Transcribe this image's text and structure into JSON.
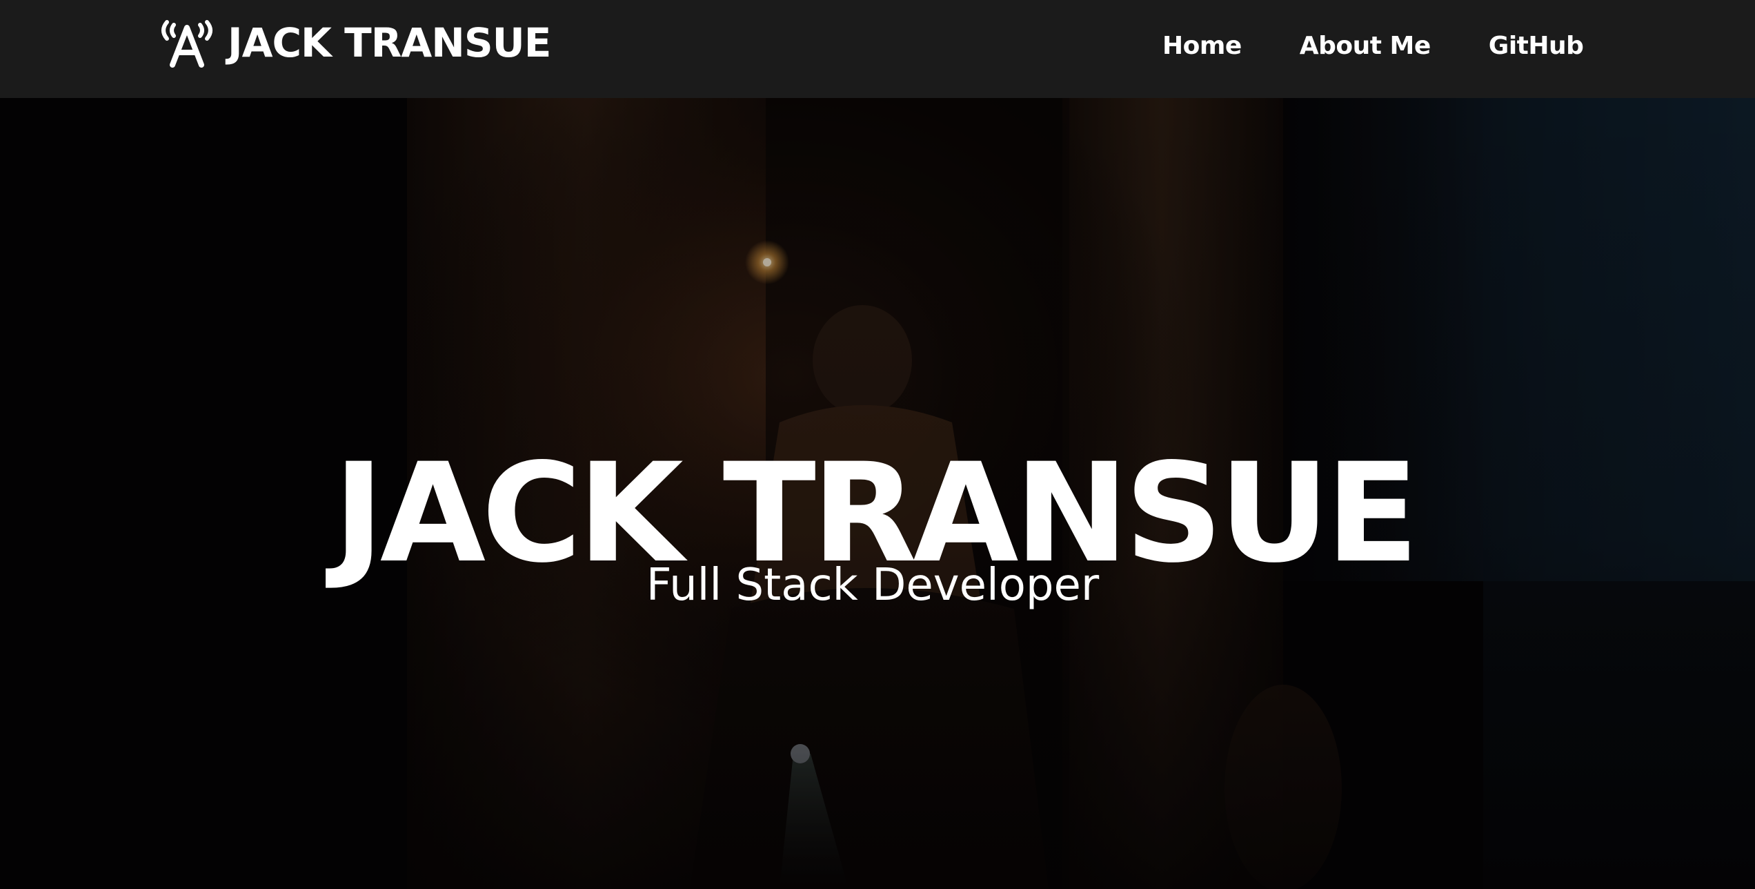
{
  "navbar": {
    "brand": {
      "icon": "radio-tower-icon",
      "text": "JACK TRANSUE"
    },
    "links": [
      {
        "label": "Home"
      },
      {
        "label": "About Me"
      },
      {
        "label": "GitHub"
      }
    ]
  },
  "hero": {
    "title": "JACK TRANSUE",
    "subtitle": "Full Stack Developer",
    "background": "dark-concert-photo"
  },
  "colors": {
    "navbar_bg": "#1b1b1b",
    "hero_bg": "#060405",
    "text": "#ffffff"
  }
}
